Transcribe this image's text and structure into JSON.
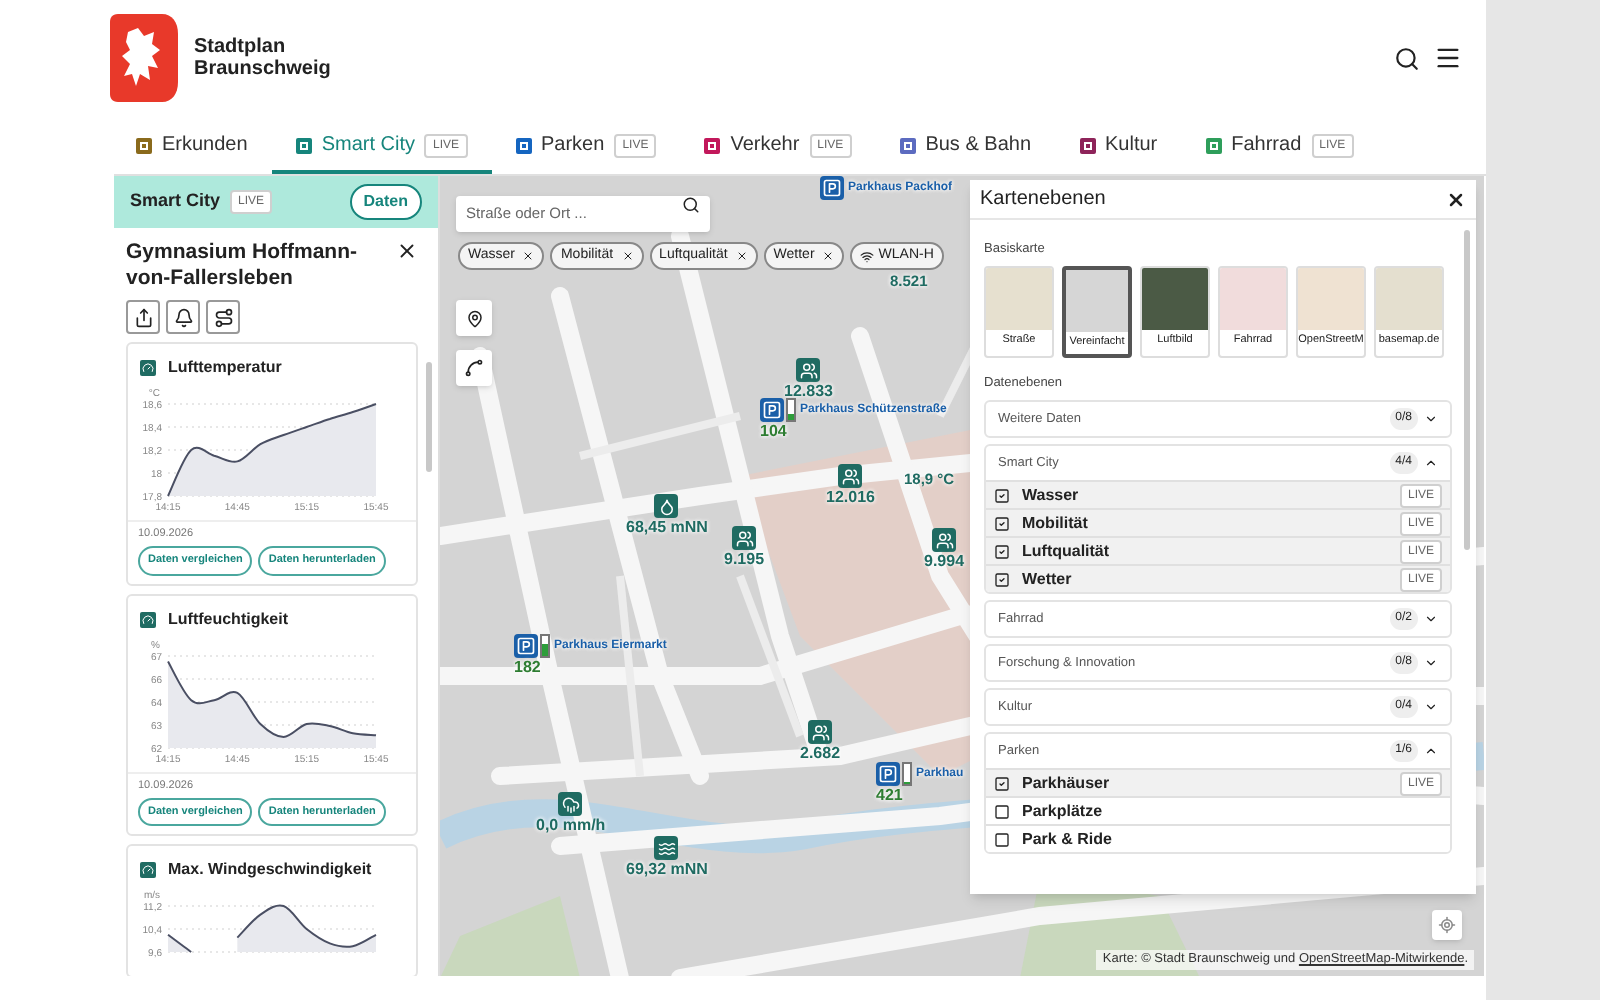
{
  "header": {
    "title_line_1": "Stadtplan",
    "title_line_2": "Braunschweig"
  },
  "tabs": [
    {
      "label": "Erkunden",
      "selected": false,
      "color": "#8a6a1c"
    },
    {
      "label": "Smart City",
      "selected": true,
      "badge": "LIVE",
      "color": "#16857c"
    },
    {
      "label": "Parken",
      "selected": false,
      "badge": "LIVE",
      "color": "#1565c0"
    },
    {
      "label": "Verkehr",
      "selected": false,
      "badge": "LIVE",
      "color": "#c2185b"
    },
    {
      "label": "Bus & Bahn",
      "selected": false,
      "color": "#5c6bc0"
    },
    {
      "label": "Kultur",
      "selected": false,
      "color": "#8e245a"
    },
    {
      "label": "Fahrrad",
      "selected": false,
      "badge": "LIVE",
      "color": "#2e9e5b"
    }
  ],
  "side_panel": {
    "title": "Smart City",
    "badge": "LIVE",
    "button": "Daten",
    "heading": "Gymnasium Hoffmann-von-Fallersleben",
    "cards": [
      {
        "title": "Lufttemperatur",
        "date": "10.09.2026",
        "buttons": [
          "Daten vergleichen",
          "Daten herunterladen"
        ],
        "chart_data": {
          "type": "area",
          "ylabel": "°C",
          "categories": [
            "14:15",
            null,
            null,
            "14:45",
            null,
            null,
            "15:15",
            null,
            null,
            "15:45"
          ],
          "series": [
            {
              "color": "#4a4f63",
              "values": [
                17.8,
                18.2,
                18.15,
                18.1,
                18.25,
                18.33,
                18.4,
                18.47,
                18.53,
                18.6
              ]
            }
          ],
          "grid": true,
          "ylim": [
            17.8,
            18.6
          ],
          "yticks": [
            {
              "value": 18.6,
              "label": "18,6"
            },
            {
              "value": 18.4,
              "label": "18,4"
            },
            {
              "value": 18.2,
              "label": "18,2"
            },
            {
              "value": 18,
              "label": "18"
            },
            {
              "value": 17.8,
              "label": "17,8"
            }
          ]
        }
      },
      {
        "title": "Luftfeuchtigkeit",
        "date": "10.09.2026",
        "buttons": [
          "Daten vergleichen",
          "Daten herunterladen"
        ],
        "chart_data": {
          "type": "area",
          "ylabel": "%",
          "categories": [
            "14:15",
            null,
            null,
            "14:45",
            null,
            null,
            "15:15",
            null,
            null,
            "15:45"
          ],
          "series": [
            {
              "color": "#4a4f63",
              "values": [
                66.7,
                64.6,
                64.6,
                65,
                63.3,
                62.6,
                63.3,
                63.2,
                62.8,
                62.7
              ]
            }
          ],
          "grid": true,
          "ylim": [
            62,
            67
          ],
          "yticks": [
            {
              "value": 67,
              "label": "67"
            },
            {
              "value": 65.75,
              "label": "66"
            },
            {
              "value": 64.5,
              "label": "64"
            },
            {
              "value": 63.25,
              "label": "63"
            },
            {
              "value": 62,
              "label": "62"
            }
          ]
        }
      },
      {
        "title": "Max. Windgeschwindigkeit",
        "chart_data": {
          "type": "area",
          "ylabel": "m/s",
          "series": [
            {
              "color": "#4a4f63",
              "values": [
                10.2,
                9.6,
                null,
                10.1,
                10.9,
                11.2,
                10.4,
                9.9,
                9.8,
                10.2
              ]
            }
          ],
          "grid": true,
          "ylim": [
            9.6,
            11.2
          ],
          "yticks": [
            {
              "value": 11.2,
              "label": "11,2"
            },
            {
              "value": 10.4,
              "label": "10,4"
            },
            {
              "value": 9.6,
              "label": "9,6"
            }
          ]
        }
      }
    ]
  },
  "map": {
    "search": {
      "placeholder": "Straße oder Ort ..."
    },
    "filter_chips": [
      {
        "label": "Wasser",
        "removable": true
      },
      {
        "label": "Mobilität",
        "removable": true
      },
      {
        "label": "Luftqualität",
        "removable": true
      },
      {
        "label": "Wetter",
        "removable": true
      },
      {
        "label": "WLAN-H",
        "removable": false
      }
    ],
    "markers": [
      {
        "kind": "parking",
        "label": "Parkhaus Packhof"
      },
      {
        "kind": "label",
        "value": "8.521"
      },
      {
        "kind": "counter",
        "value": "12.833"
      },
      {
        "kind": "parking",
        "label": "Parkhaus Schützenstraße",
        "value": "104",
        "level": 0.3
      },
      {
        "kind": "counter",
        "value": "12.016"
      },
      {
        "kind": "label",
        "value": "18,9 °C"
      },
      {
        "kind": "counter",
        "value": "9.994"
      },
      {
        "kind": "counter",
        "value": "9.195"
      },
      {
        "kind": "water",
        "value": "68,45 mNN"
      },
      {
        "kind": "parking",
        "label": "Parkhaus Eiermarkt",
        "value": "182",
        "level": 0.6
      },
      {
        "kind": "counter",
        "value": "2.682"
      },
      {
        "kind": "parking",
        "label": "Parkhau",
        "value": "421",
        "level": 0.1
      },
      {
        "kind": "rain",
        "value": "0,0 mm/h"
      },
      {
        "kind": "waves",
        "value": "69,32 mNN"
      }
    ],
    "attribution": {
      "text": "Karte: © Stadt Braunschweig und",
      "link": "OpenStreetMap-Mitwirkende",
      "suffix": "."
    }
  },
  "layers_panel": {
    "title": "Kartenebenen",
    "base_heading": "Basiskarte",
    "base_maps": [
      {
        "label": "Straße",
        "selected": false,
        "color": "#e6e0cf"
      },
      {
        "label": "Vereinfacht",
        "selected": true,
        "color": "#d6d6d6"
      },
      {
        "label": "Luftbild",
        "selected": false,
        "color": "#4b5a45"
      },
      {
        "label": "Fahrrad",
        "selected": false,
        "color": "#f1dcdc"
      },
      {
        "label": "OpenStreetM",
        "selected": false,
        "color": "#efe2d2"
      },
      {
        "label": "basemap.de",
        "selected": false,
        "color": "#e4dfcf"
      }
    ],
    "data_heading": "Datenebenen",
    "groups": [
      {
        "name": "Weitere Daten",
        "count": "0/8",
        "expanded": false
      },
      {
        "name": "Smart City",
        "count": "4/4",
        "expanded": true,
        "items": [
          {
            "label": "Wasser",
            "checked": true,
            "badge": "LIVE"
          },
          {
            "label": "Mobilität",
            "checked": true,
            "badge": "LIVE"
          },
          {
            "label": "Luftqualität",
            "checked": true,
            "badge": "LIVE"
          },
          {
            "label": "Wetter",
            "checked": true,
            "badge": "LIVE"
          }
        ]
      },
      {
        "name": "Fahrrad",
        "count": "0/2",
        "expanded": false
      },
      {
        "name": "Forschung & Innovation",
        "count": "0/8",
        "expanded": false
      },
      {
        "name": "Kultur",
        "count": "0/4",
        "expanded": false
      },
      {
        "name": "Parken",
        "count": "1/6",
        "expanded": true,
        "items": [
          {
            "label": "Parkhäuser",
            "checked": true,
            "badge": "LIVE"
          },
          {
            "label": "Parkplätze",
            "checked": false
          },
          {
            "label": "Park & Ride",
            "checked": false
          }
        ]
      }
    ]
  }
}
